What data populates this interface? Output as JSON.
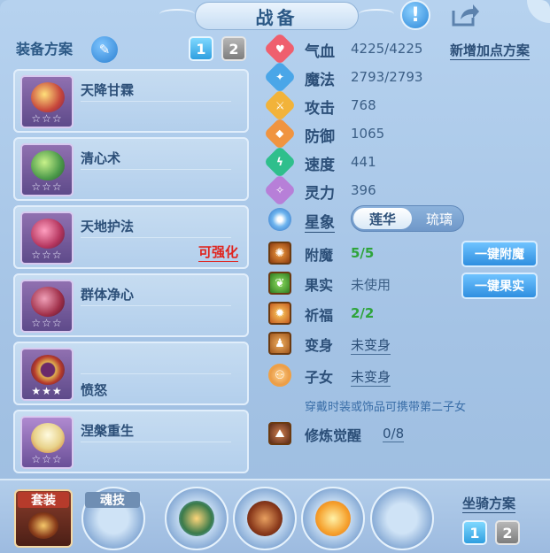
{
  "title": "战备",
  "left": {
    "heading": "装备方案",
    "tabs": [
      "1",
      "2"
    ]
  },
  "equipment": [
    {
      "name": "天降甘霖",
      "stars": "☆☆☆",
      "color": "#c7473b"
    },
    {
      "name": "清心术",
      "stars": "☆☆☆",
      "color": "#4c9a4a"
    },
    {
      "name": "天地护法",
      "stars": "☆☆☆",
      "color": "#b5365f",
      "tag": "可强化"
    },
    {
      "name": "群体净心",
      "stars": "☆☆☆",
      "color": "#a0304a"
    },
    {
      "name": "愤怒",
      "stars": "★★★",
      "color": "#b53a2c"
    },
    {
      "name": "涅槃重生",
      "stars": "☆☆☆",
      "color": "#e8d28a"
    }
  ],
  "add_plan": "新增加点方案",
  "stats": [
    {
      "label": "气血",
      "value": "4225/4225",
      "color": "#ef5f6e",
      "glyph": "♥"
    },
    {
      "label": "魔法",
      "value": "2793/2793",
      "color": "#4aa6e8",
      "glyph": "✦"
    },
    {
      "label": "攻击",
      "value": "768",
      "color": "#f2b33a",
      "glyph": "⚔"
    },
    {
      "label": "防御",
      "value": "1065",
      "color": "#f09440",
      "glyph": "◆"
    },
    {
      "label": "速度",
      "value": "441",
      "color": "#2fbf8c",
      "glyph": "ϟ"
    },
    {
      "label": "灵力",
      "value": "396",
      "color": "#b77fd8",
      "glyph": "✧"
    }
  ],
  "star_image": {
    "label": "星象",
    "options": [
      "莲华",
      "琉璃"
    ]
  },
  "abilities": [
    {
      "label": "附魔",
      "value": "5/5",
      "style": "green",
      "color": "#b6651f"
    },
    {
      "label": "果实",
      "value": "未使用",
      "style": "plain",
      "color": "#3f8f2f"
    },
    {
      "label": "祈福",
      "value": "2/2",
      "style": "green",
      "color": "#c35a1f"
    },
    {
      "label": "变身",
      "value": "未变身",
      "style": "link",
      "color": "#c97a2c"
    },
    {
      "label": "子女",
      "value": "未变身",
      "style": "link",
      "color": "#f0a044"
    }
  ],
  "actions": [
    "一键附魔",
    "一键果实"
  ],
  "hint": "穿戴时装或饰品可携带第二子女",
  "cultivation": {
    "label": "修炼觉醒",
    "value": "0/8"
  },
  "bottom": {
    "suit": "套装",
    "soul": "魂技",
    "mount_plan": "坐骑方案",
    "mount_tabs": [
      "1",
      "2"
    ]
  }
}
